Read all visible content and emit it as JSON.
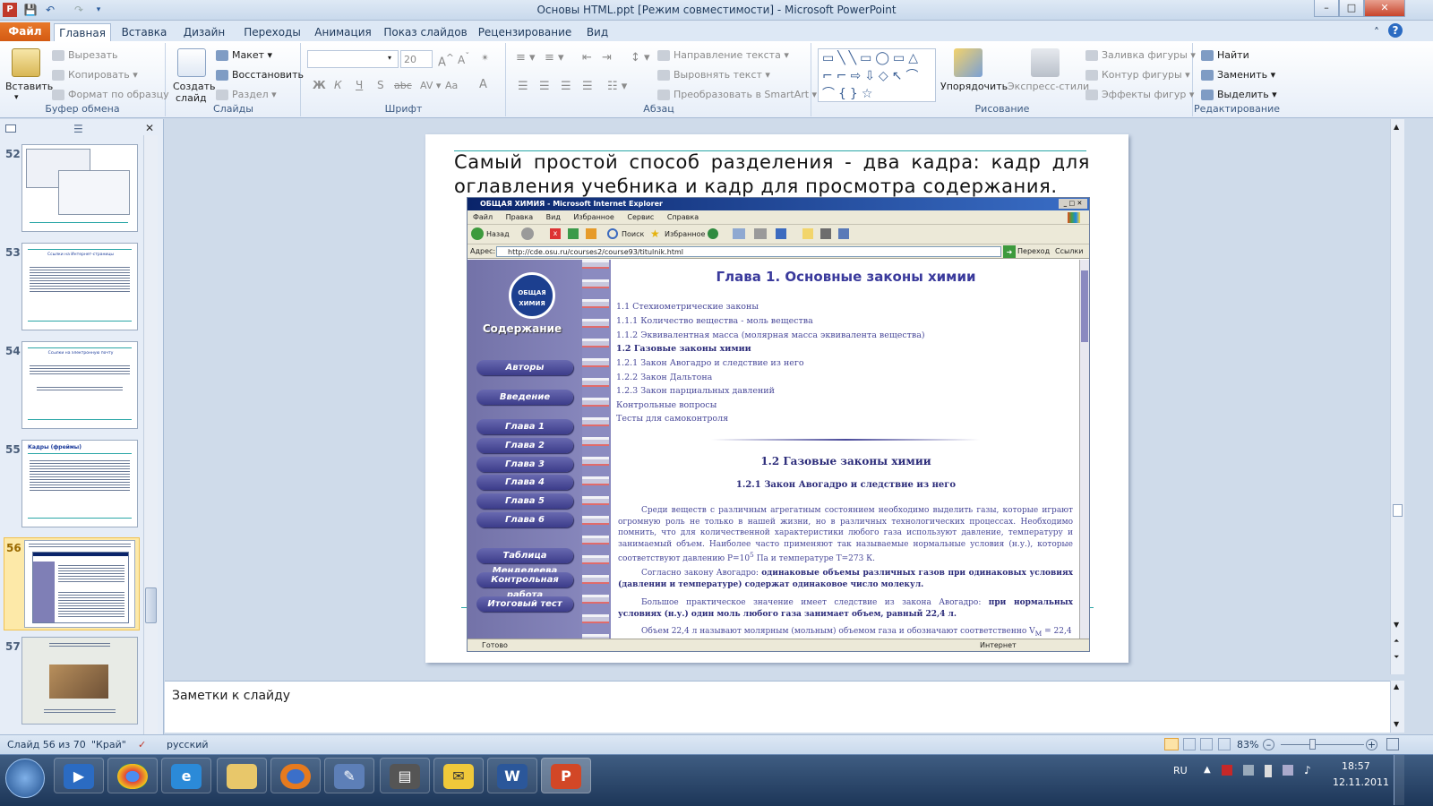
{
  "window": {
    "title": "Основы HTML.ppt [Режим совместимости]  -  Microsoft PowerPoint",
    "controls": [
      "–",
      "□",
      "✕"
    ]
  },
  "tabs": [
    "Файл",
    "Главная",
    "Вставка",
    "Дизайн",
    "Переходы",
    "Анимация",
    "Показ слайдов",
    "Рецензирование",
    "Вид"
  ],
  "ribbon": {
    "clipboard": {
      "label": "Буфер обмена",
      "paste": "Вставить",
      "cut": "Вырезать",
      "copy": "Копировать",
      "format": "Формат по образцу"
    },
    "slides": {
      "label": "Слайды",
      "new_slide_1": "Создать",
      "new_slide_2": "слайд",
      "layout": "Макет",
      "reset": "Восстановить",
      "section": "Раздел"
    },
    "font": {
      "label": "Шрифт",
      "font_name": "",
      "font_size": "20",
      "buttons": [
        "Ж",
        "К",
        "Ч",
        "S",
        "abc",
        "Aa",
        "A"
      ]
    },
    "paragraph": {
      "label": "Абзац",
      "text_direction": "Направление текста",
      "align_text": "Выровнять текст",
      "smartart": "Преобразовать в SmartArt"
    },
    "drawing": {
      "label": "Рисование",
      "arrange": "Упорядочить",
      "quick_styles": "Экспресс-стили",
      "fill": "Заливка фигуры",
      "outline": "Контур фигуры",
      "effects": "Эффекты фигур"
    },
    "editing": {
      "label": "Редактирование",
      "find": "Найти",
      "replace": "Заменить",
      "select": "Выделить"
    }
  },
  "thumbnails": [
    {
      "num": "52",
      "title": ""
    },
    {
      "num": "53",
      "title": "Ссылки на Интернет-страницы"
    },
    {
      "num": "54",
      "title": "Ссылки на электронную почту"
    },
    {
      "num": "55",
      "title": "Кадры (фреймы)"
    },
    {
      "num": "56",
      "title": ""
    },
    {
      "num": "57",
      "title": ""
    }
  ],
  "slide": {
    "text": "Самый простой способ разделения - два кадра: кадр для оглавления учебника и кадр для просмотра содержания."
  },
  "ie": {
    "title": "ОБЩАЯ ХИМИЯ - Microsoft Internet Explorer",
    "menu": [
      "Файл",
      "Правка",
      "Вид",
      "Избранное",
      "Сервис",
      "Справка"
    ],
    "toolbar": {
      "back": "Назад",
      "search": "Поиск",
      "favorites": "Избранное"
    },
    "address_label": "Адрес:",
    "address": "http://cde.osu.ru/courses2/course93/titulnik.html",
    "go": "Переход",
    "links": "Ссылки",
    "logo_text": "ОБЩАЯ ХИМИЯ",
    "nav_heading": "Содержание",
    "nav": [
      "Авторы",
      "Введение",
      "Глава 1",
      "Глава 2",
      "Глава 3",
      "Глава 4",
      "Глава 5",
      "Глава 6",
      "Таблица Менделеева",
      "Контрольная работа",
      "Итоговый тест"
    ],
    "content": {
      "chapter_title": "Глава 1. Основные законы химии",
      "toc": [
        "1.1 Стехиометрические законы",
        "1.1.1 Количество вещества - моль вещества",
        "1.1.2 Эквивалентная масса (молярная масса эквивалента вещества)",
        "1.2 Газовые законы химии",
        "1.2.1 Закон Авогадро и следствие из него",
        "1.2.2 Закон Дальтона",
        "1.2.3 Закон парциальных давлений",
        "Контрольные вопросы",
        "Тесты для самоконтроля"
      ],
      "section_title": "1.2 Газовые законы химии",
      "subsection_title": "1.2.1 Закон Авогадро и следствие из него",
      "p1": "Среди веществ с различным агрегатным состоянием необходимо выделить газы, которые играют огромную роль не только в нашей жизни, но в различных технологических процессах. Необходимо помнить, что для количественной характеристики любого газа используют давление, температуру и занимаемый объем. Наиболее часто применяют так называемые нормальные условия (н.у.), которые соответствуют давлению P=10",
      "p1_sup": "5",
      "p1_end": " Па и температуре T=273 К.",
      "p2_start": "Согласно закону Авогадро: ",
      "p2_bold": "одинаковые объемы различных газов при одинаковых условиях (давлении и температуре) содержат одинаковое число молекул.",
      "p3_start": "Большое практическое значение имеет следствие из закона Авогадро: ",
      "p3_bold": "при нормальных условиях (н.у.) один моль любого газа занимает объем, равный 22,4 л.",
      "p4": "Объем 22,4 л называют молярным (мольным) объемом газа и обозначают соответственно V",
      "p4_sub": "M",
      "p4_end": " = 22,4"
    },
    "status_left": "Готово",
    "status_right": "Интернет"
  },
  "notes_placeholder": "Заметки к слайду",
  "statusbar": {
    "slide": "Слайд 56 из 70",
    "theme": "\"Край\"",
    "lang": "русский",
    "zoom": "83%"
  },
  "taskbar": {
    "lang": "RU",
    "time": "18:57",
    "date": "12.11.2011"
  },
  "colors": {
    "accent": "#2b579a",
    "file_tab": "#d45a12",
    "ie_text": "#4a4a9a",
    "nav_bg": "#7f7fb6"
  }
}
